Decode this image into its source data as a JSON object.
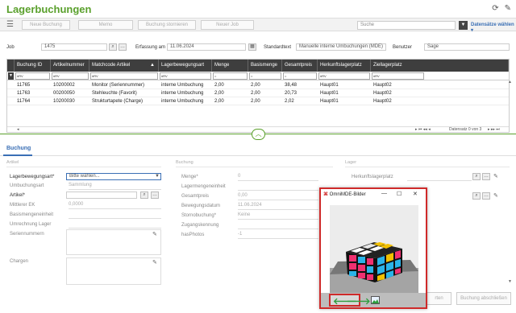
{
  "app": {
    "title": "Lagerbuchungen"
  },
  "toolbar": {
    "new_booking": "Neue Buchung",
    "memo": "Memo",
    "cancel_booking": "Buchung stornieren",
    "new_job": "Neuer Job",
    "search_placeholder": "Suche",
    "select_records": "Datensätze wählen"
  },
  "header_form": {
    "job_label": "Job",
    "job_value": "1475",
    "date_label": "Erfassung am",
    "date_value": "11.06.2024",
    "standardtext_label": "Standardtext",
    "standardtext_value": "Manuelle interne Umbuchungen (MDE)",
    "user_label": "Benutzer",
    "user_value": "Sage"
  },
  "grid": {
    "columns": [
      "Buchung ID",
      "Artikelnummer",
      "Matchcode Artikel",
      "Lagerbewegungsart",
      "Menge",
      "Basismenge",
      "Gesamtpreis",
      "Herkunftslagerplatz",
      "Ziellagerplatz"
    ],
    "filters": [
      "#RV",
      "#RV",
      "#RV",
      "#RV",
      "=",
      "=",
      "=",
      "#RV",
      "#RV"
    ],
    "rows": [
      [
        "11765",
        "10200002",
        "Monitor (Seriennummer)",
        "interne Umbuchung",
        "2,00",
        "2,00",
        "38,48",
        "Haupt01",
        "Haupt02"
      ],
      [
        "11763",
        "00200050",
        "Stehleuchte  (Favorit)",
        "interne Umbuchung",
        "2,00",
        "2,00",
        "20,73",
        "Haupt01",
        "Haupt02"
      ],
      [
        "11764",
        "10200030",
        "Strukturtapete (Charge)",
        "interne Umbuchung",
        "2,00",
        "2,00",
        "2,02",
        "Haupt01",
        "Haupt02"
      ]
    ],
    "pager_text": "Datensatz 0 von 3"
  },
  "tab": {
    "label": "Buchung"
  },
  "artikel_section": {
    "title": "Artikel",
    "lagerbewegungsart_label": "Lagerbewegungsart*",
    "lagerbewegungsart_value": "Bitte wählen...",
    "umbuchungsart_label": "Umbuchungsart",
    "umbuchungsart_value": "Sammlung",
    "artikel_label": "Artikel*",
    "mittlerer_ek_label": "Mittlerer EK",
    "mittlerer_ek_value": "0,0000",
    "basismengeneinheit_label": "Basismengeneinheit",
    "umrechnung_label": "Umrechnung Lager",
    "seriennummern_label": "Seriennummern",
    "chargen_label": "Chargen"
  },
  "buchung_section": {
    "title": "Buchung",
    "menge_label": "Menge*",
    "menge_value": "0",
    "lagermengeneinheit_label": "Lagermengeneinheit",
    "gesamtpreis_label": "Gesamtpreis",
    "gesamtpreis_value": "0,00",
    "bewegungsdatum_label": "Bewegungsdatum",
    "bewegungsdatum_value": "11.06.2024",
    "stornobuchung_label": "Stornobuchung*",
    "stornobuchung_value": "Keine",
    "zugangskennung_label": "Zugangskennung",
    "hasphotos_label": "hasPhotos",
    "hasphotos_value": "-1"
  },
  "lager_section": {
    "title": "Lager",
    "herkunft_label": "Herkunftslagerplatz"
  },
  "dialog": {
    "title": "OmniMDE-Bilder",
    "image_alt": "Rubik's cube photo"
  },
  "bottom_buttons": {
    "partial": "rten",
    "finish": "Buchung abschließen"
  },
  "colors": {
    "accent_green": "#5aa02c",
    "link_blue": "#3a6fb5",
    "highlight_red": "#cf2a2a"
  }
}
